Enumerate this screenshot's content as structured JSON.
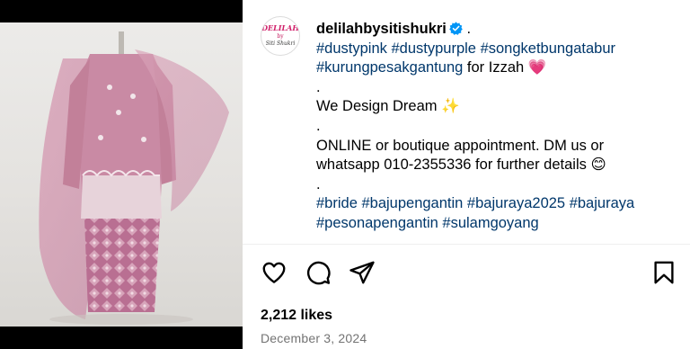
{
  "post": {
    "username": "delilahbysitishukri",
    "avatar_text": [
      "DELILAH",
      "by",
      "Siti Shukri"
    ],
    "caption_lines": [
      {
        "parts": [
          {
            "t": "delilahbysitishukri",
            "k": "user"
          },
          {
            "t": " .",
            "k": "text"
          }
        ]
      },
      {
        "parts": [
          {
            "t": "#dustypink",
            "k": "tag"
          },
          {
            "t": " ",
            "k": "text"
          },
          {
            "t": "#dustypurple",
            "k": "tag"
          },
          {
            "t": " ",
            "k": "text"
          },
          {
            "t": "#songketbungatabur",
            "k": "tag"
          }
        ]
      },
      {
        "parts": [
          {
            "t": "#kurungpesakgantung",
            "k": "tag"
          },
          {
            "t": " for Izzah 💗",
            "k": "text"
          }
        ]
      },
      {
        "parts": [
          {
            "t": ".",
            "k": "text"
          }
        ]
      },
      {
        "parts": [
          {
            "t": "We Design Dream ✨",
            "k": "text"
          }
        ]
      },
      {
        "parts": [
          {
            "t": ".",
            "k": "text"
          }
        ]
      },
      {
        "parts": [
          {
            "t": "ONLINE or boutique appointment. DM us or",
            "k": "text"
          }
        ]
      },
      {
        "parts": [
          {
            "t": "whatsapp 010-2355336 for further details 😊",
            "k": "text"
          }
        ]
      },
      {
        "parts": [
          {
            "t": ".",
            "k": "text"
          }
        ]
      },
      {
        "parts": [
          {
            "t": "#bride",
            "k": "tag"
          },
          {
            "t": " ",
            "k": "text"
          },
          {
            "t": "#bajupengantin",
            "k": "tag"
          },
          {
            "t": " ",
            "k": "text"
          },
          {
            "t": "#bajuraya2025",
            "k": "tag"
          },
          {
            "t": " ",
            "k": "text"
          },
          {
            "t": "#bajuraya",
            "k": "tag"
          }
        ]
      },
      {
        "parts": [
          {
            "t": "#pesonapengantin",
            "k": "tag"
          },
          {
            "t": " ",
            "k": "text"
          },
          {
            "t": "#sulamgoyang",
            "k": "tag"
          }
        ]
      }
    ],
    "likes_text": "2,212 likes",
    "date_text": "December 3, 2024"
  },
  "icons": {
    "like": "heart-icon",
    "comment": "comment-icon",
    "share": "share-icon",
    "save": "bookmark-icon",
    "verified": "verified-badge-icon"
  },
  "colors": {
    "hashtag": "#00376b",
    "verified": "#0095f6",
    "date": "#737373"
  }
}
